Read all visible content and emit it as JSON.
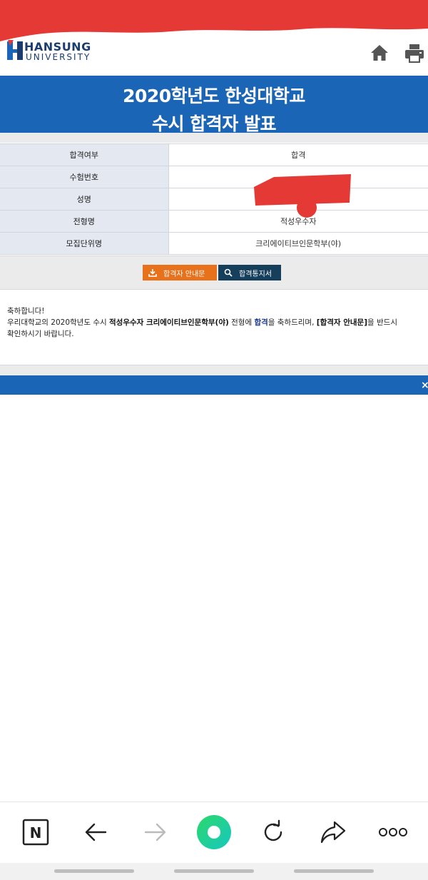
{
  "header": {
    "logo_line1": "HANSUNG",
    "logo_line2": "UNIVERSITY",
    "icons": [
      "home-icon",
      "print-icon"
    ]
  },
  "banner": {
    "title_line1": "2020학년도 한성대학교",
    "title_line2": "수시 합격자 발표"
  },
  "info_table": {
    "rows": [
      {
        "label": "합격여부",
        "value": "합격"
      },
      {
        "label": "수험번호",
        "value": ""
      },
      {
        "label": "성명",
        "value": ""
      },
      {
        "label": "전형명",
        "value": "적성우수자"
      },
      {
        "label": "모집단위명",
        "value": "크리에이티브인문학부(야)"
      }
    ]
  },
  "buttons": {
    "guide_label": "합격자 안내문",
    "notice_label": "합격통지서"
  },
  "message": {
    "line1": "축하합니다!",
    "p1": "우리대학교의 2020학년도 수시 ",
    "track": "적성우수자 크리에이티브인문학부(야)",
    "p2": " 전형에 ",
    "result": "합격",
    "p3": "을 축하드리며, ",
    "doc": "[합격자 안내문]",
    "p4": "을 반드시",
    "line3": "확인하시기 바랍니다."
  },
  "overlay": {
    "close_symbol": "×"
  },
  "browser_toolbar": {
    "naver_letter": "N",
    "icons": [
      "naver-icon",
      "back-icon",
      "forward-icon",
      "green-dot-icon",
      "reload-icon",
      "share-icon",
      "more-icon"
    ]
  },
  "colors": {
    "brand_blue": "#1b65b6",
    "table_header_bg": "#e3e8f1",
    "guide_button": "#e8711b",
    "notice_button": "#163f5c",
    "redaction_red": "#e53935",
    "highlight_text": "#1a3690"
  }
}
